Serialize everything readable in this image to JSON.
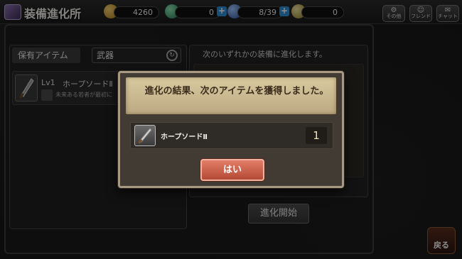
{
  "header": {
    "title": "装備進化所",
    "resources": {
      "gold": "4260",
      "gems": "0",
      "stamina": "8/39",
      "medals": "0"
    },
    "buttons": {
      "other": "その他",
      "friend": "フレンド",
      "chat": "チャット"
    }
  },
  "left_panel": {
    "tab_label": "保有アイテム",
    "filter_value": "武器",
    "items": [
      {
        "level": "Lv1",
        "name": "ホープソードⅡ",
        "description": "未来ある若者が最初に"
      }
    ]
  },
  "right_panel": {
    "header": "次のいずれかの装備に進化します。"
  },
  "evolve_button_label": "進化開始",
  "back_button_label": "戻る",
  "dialog": {
    "message": "進化の結果、次のアイテムを獲得しました。",
    "result_item_name": "ホープソードⅡ",
    "result_item_quantity": "1",
    "confirm_label": "はい"
  },
  "colors": {
    "confirm_button": "#c9604b",
    "dialog_header": "#cdbd96",
    "plus_button": "#2f8fd8"
  },
  "icons": {
    "gold": "gold-coin-icon",
    "gems": "green-gem-icon",
    "stamina": "blue-orb-icon",
    "medals": "medal-icon"
  }
}
